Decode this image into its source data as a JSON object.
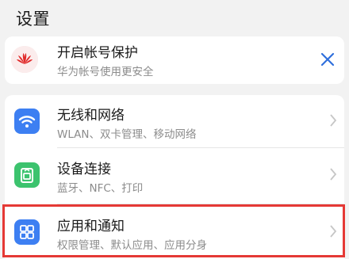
{
  "header": {
    "title": "设置"
  },
  "account": {
    "title": "开启帐号保护",
    "subtitle": "华为帐号使用更安全",
    "icon": "huawei-logo-icon",
    "dismiss_icon": "close-icon"
  },
  "settings": {
    "items": [
      {
        "title": "无线和网络",
        "subtitle": "WLAN、双卡管理、移动网络",
        "icon": "wifi-icon"
      },
      {
        "title": "设备连接",
        "subtitle": "蓝牙、NFC、打印",
        "icon": "device-connection-icon"
      },
      {
        "title": "应用和通知",
        "subtitle": "权限管理、默认应用、应用分身",
        "icon": "apps-grid-icon"
      }
    ]
  },
  "colors": {
    "accent_blue": "#3d7ff2",
    "accent_green": "#3cc36e",
    "highlight_red": "#e53935",
    "huawei_red": "#e02828"
  }
}
